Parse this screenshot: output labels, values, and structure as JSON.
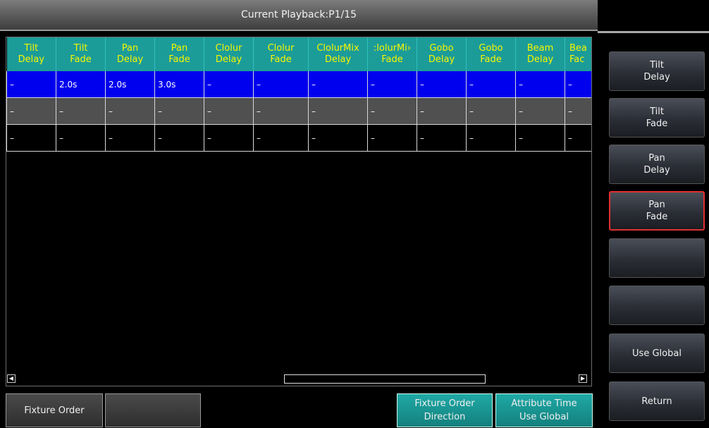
{
  "header": {
    "title": "Current Playback:P1/15"
  },
  "table": {
    "columns": [
      [
        "Tilt",
        "Delay"
      ],
      [
        "Tilt",
        "Fade"
      ],
      [
        "Pan",
        "Delay"
      ],
      [
        "Pan",
        "Fade"
      ],
      [
        "Clolur",
        "Delay"
      ],
      [
        "Clolur",
        "Fade"
      ],
      [
        "ClolurMix",
        "Delay"
      ],
      [
        ":lolurMi›",
        "Fade"
      ],
      [
        "Gobo",
        "Delay"
      ],
      [
        "Gobo",
        "Fade"
      ],
      [
        "Beam",
        "Delay"
      ],
      [
        "Bea",
        "Fac"
      ]
    ],
    "rows": [
      [
        "–",
        "2.0s",
        "2.0s",
        "3.0s",
        "–",
        "–",
        "–",
        "–",
        "–",
        "–",
        "–",
        "–"
      ],
      [
        "–",
        "–",
        "–",
        "–",
        "–",
        "–",
        "–",
        "–",
        "–",
        "–",
        "–",
        "–"
      ],
      [
        "–",
        "–",
        "–",
        "–",
        "–",
        "–",
        "–",
        "–",
        "–",
        "–",
        "–",
        "–"
      ]
    ]
  },
  "scrollbar": {
    "left_arrow": "◀",
    "right_arrow": "▶"
  },
  "side_buttons": [
    {
      "line1": "Tilt",
      "line2": "Delay"
    },
    {
      "line1": "Tilt",
      "line2": "Fade"
    },
    {
      "line1": "Pan",
      "line2": "Delay"
    },
    {
      "line1": "Pan",
      "line2": "Fade"
    },
    {
      "line1": "",
      "line2": ""
    },
    {
      "line1": "",
      "line2": ""
    },
    {
      "line1": "Use Global",
      "line2": ""
    },
    {
      "line1": "Return",
      "line2": ""
    }
  ],
  "bottom_buttons": [
    {
      "line1": "Fixture Order",
      "line2": ""
    },
    {
      "line1": "",
      "line2": ""
    },
    {
      "line1": "Fixture Order",
      "line2": "Direction"
    },
    {
      "line1": "Attribute Time",
      "line2": "Use Global"
    }
  ],
  "colors": {
    "header_bg": "#1c9c99",
    "header_text": "#f6f600",
    "selected_row": "#0000ee",
    "alt_row": "#505050",
    "active_border": "#e03030"
  }
}
